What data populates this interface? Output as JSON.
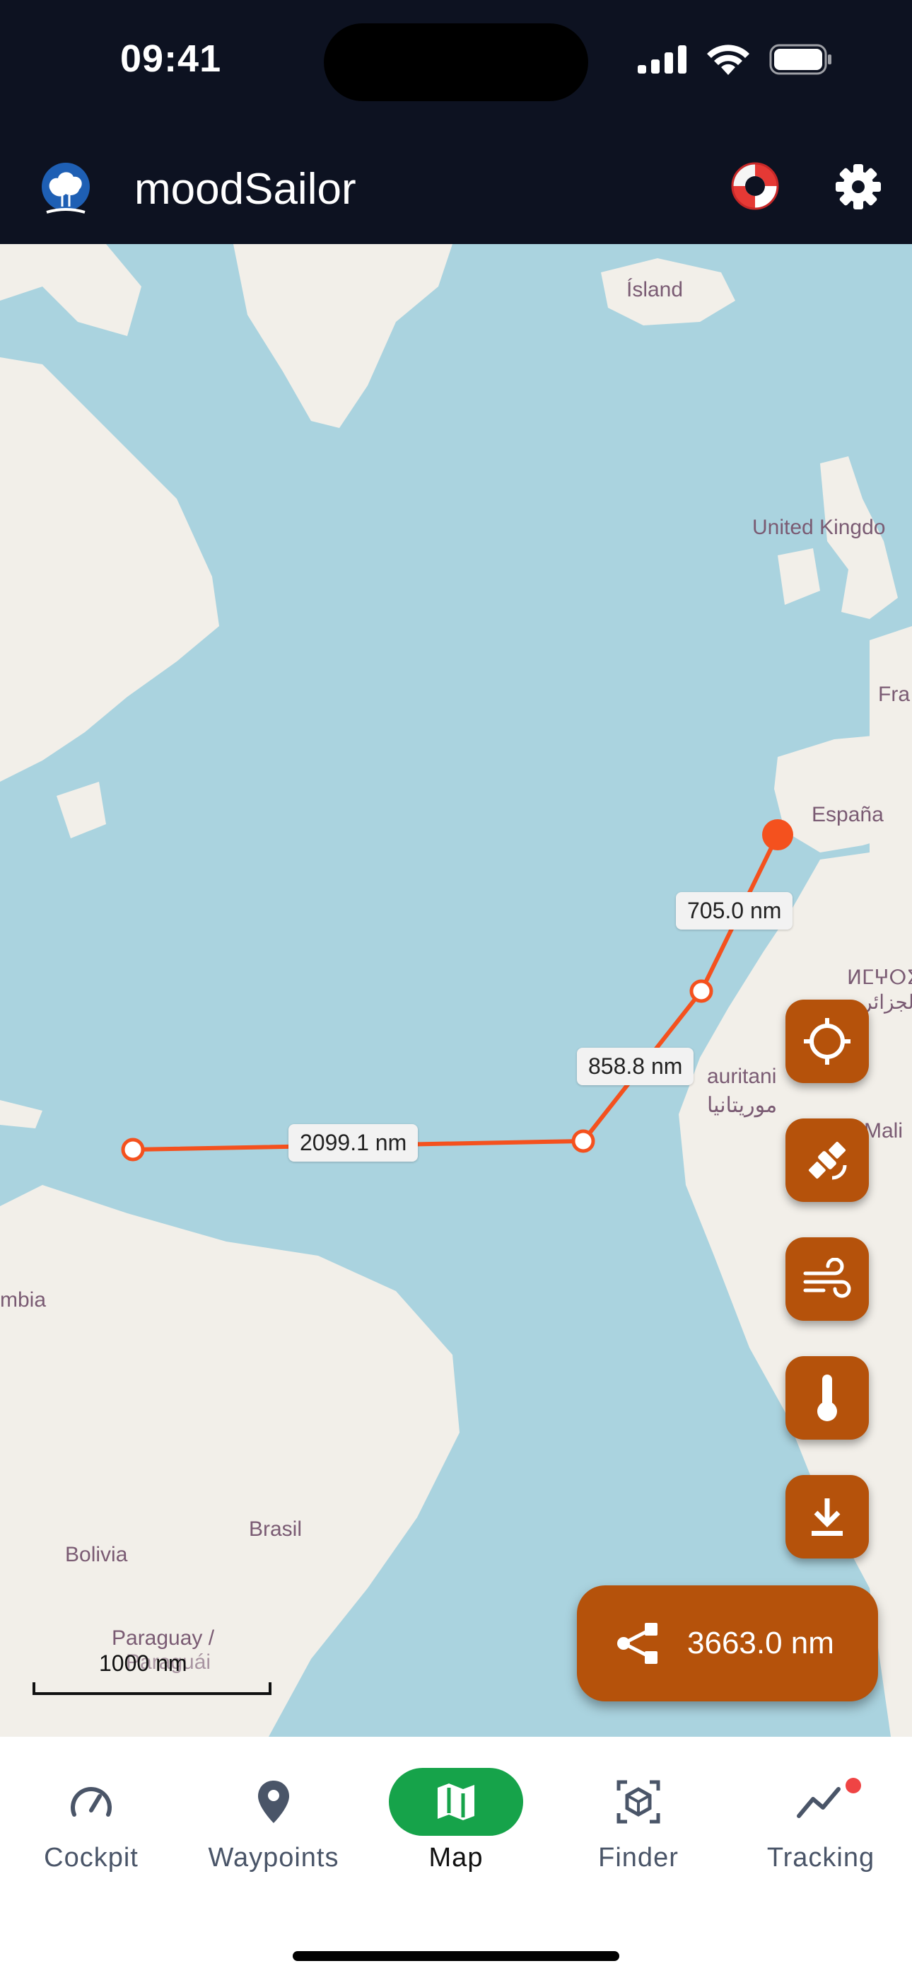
{
  "status_bar": {
    "time": "09:41"
  },
  "app_bar": {
    "title": "moodSailor"
  },
  "map": {
    "place_labels": {
      "iceland": "Ísland",
      "uk": "United Kingdo",
      "france": "Fra",
      "spain": "España",
      "morocco": "ⵍⵎⵖⵔⵉⴱ",
      "algeria": "الجزائر",
      "mauritania": "auritani",
      "mauritania_ar": "موريتانيا",
      "mali": "Mali",
      "colombia": "mbia",
      "brasil": "Brasil",
      "bolivia": "Bolivia",
      "paraguay": "Paraguay /",
      "paraguay2": "Paraguái"
    },
    "route_segments": [
      {
        "label": "705.0 nm"
      },
      {
        "label": "858.8 nm"
      },
      {
        "label": "2099.1 nm"
      }
    ],
    "scale_label": "1000 nm",
    "total_distance": "3663.0 nm",
    "route_color": "#f4511e"
  },
  "fabs": [
    {
      "icon": "crosshair-icon"
    },
    {
      "icon": "satellite-icon"
    },
    {
      "icon": "wind-icon"
    },
    {
      "icon": "thermometer-icon"
    },
    {
      "icon": "download-icon"
    }
  ],
  "accent_color": "#b5520b",
  "nav": {
    "items": [
      {
        "label": "Cockpit",
        "icon": "speedometer-icon"
      },
      {
        "label": "Waypoints",
        "icon": "map-pin-icon"
      },
      {
        "label": "Map",
        "icon": "map-icon",
        "active": true
      },
      {
        "label": "Finder",
        "icon": "cube-scan-icon"
      },
      {
        "label": "Tracking",
        "icon": "trend-icon",
        "badge": true
      }
    ]
  }
}
